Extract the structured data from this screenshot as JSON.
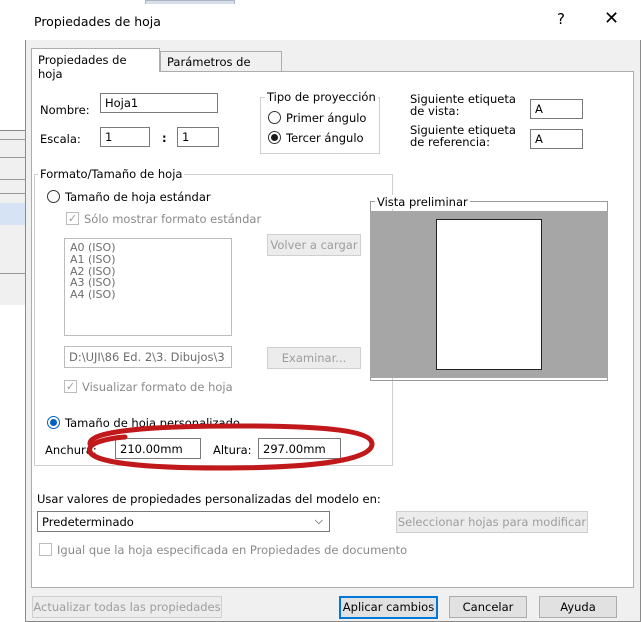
{
  "dialog": {
    "title": "Propiedades de hoja",
    "help_glyph": "?",
    "close_glyph": "✕",
    "tabs": [
      {
        "label": "Propiedades de hoja",
        "active": true
      },
      {
        "label": "Parámetros de zona",
        "active": false
      }
    ]
  },
  "sheet": {
    "name_label": "Nombre:",
    "name_value": "Hoja1",
    "scale_label": "Escala:",
    "scale_num": "1",
    "scale_sep": ":",
    "scale_den": "1"
  },
  "projection": {
    "legend": "Tipo de proyección",
    "options": [
      {
        "label": "Primer ángulo",
        "selected": false
      },
      {
        "label": "Tercer ángulo",
        "selected": true
      }
    ]
  },
  "labels": {
    "next_view_label_line1": "Siguiente etiqueta",
    "next_view_label_line2": "de vista:",
    "next_view_value": "A",
    "next_ref_label_line1": "Siguiente etiqueta",
    "next_ref_label_line2": "de referencia:",
    "next_ref_value": "A"
  },
  "format": {
    "legend": "Formato/Tamaño de hoja",
    "standard_radio": "Tamaño de hoja estándar",
    "standard_only_check": "Sólo mostrar formato estándar",
    "sizes": [
      "A0 (ISO)",
      "A1 (ISO)",
      "A2 (ISO)",
      "A3 (ISO)",
      "A4 (ISO)"
    ],
    "reload_button": "Volver a cargar",
    "path_value": "D:\\UJI\\86 Ed. 2\\3. Dibujos\\3",
    "browse_button": "Examinar...",
    "show_format_check": "Visualizar formato de hoja",
    "preview_legend": "Vista preliminar",
    "custom_radio": "Tamaño de hoja personalizado",
    "width_label": "Anchura:",
    "width_value": "210.00mm",
    "height_label": "Altura:",
    "height_value": "297.00mm"
  },
  "model": {
    "label": "Usar valores de propiedades personalizadas del modelo en:",
    "select_value": "Predeterminado",
    "select_sheets_button": "Seleccionar hojas para modificar",
    "same_as_check": "Igual que la hoja especificada en Propiedades de documento"
  },
  "footer": {
    "update_all": "Actualizar todas las propiedades",
    "apply": "Aplicar cambios",
    "cancel": "Cancelar",
    "help": "Ayuda"
  },
  "colors": {
    "annotation_ring": "#c0181b",
    "focus_blue": "#0078d7"
  }
}
